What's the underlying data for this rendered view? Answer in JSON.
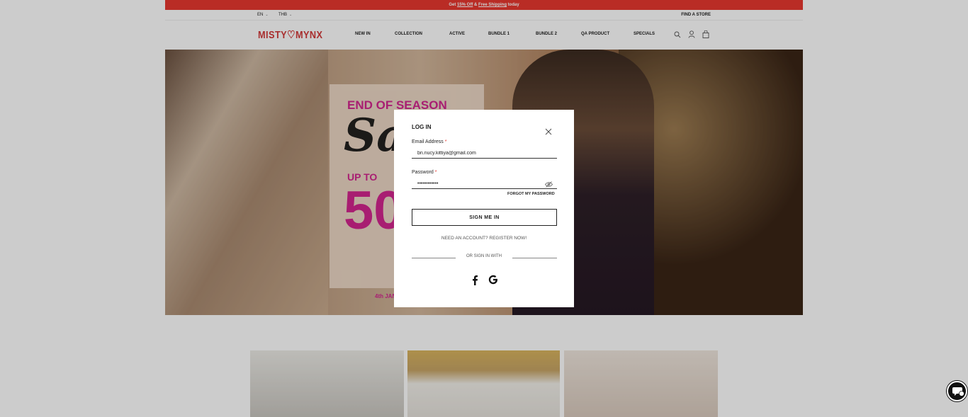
{
  "promo": {
    "prefix": "Get ",
    "discount": "15% Off",
    "middle": " & ",
    "shipping": "Free Shipping",
    "suffix": " today"
  },
  "util": {
    "language": "EN",
    "currency": "THB",
    "find_store": "FIND A STORE"
  },
  "brand": {
    "logo": "MISTY♡MYNX",
    "color": "#d23a3a"
  },
  "nav": {
    "items": [
      "NEW IN",
      "COLLECTION",
      "ACTIVE",
      "BUNDLE 1",
      "BUNDLE 2",
      "QA PRODUCT",
      "SPECIALS"
    ],
    "icons": [
      "search-icon",
      "account-icon",
      "cart-icon"
    ]
  },
  "hero": {
    "line1": "END OF SEASON",
    "line2": "Sa",
    "line3": "UP TO",
    "line4": "50",
    "line5": "4th JAN"
  },
  "login": {
    "title": "LOG IN",
    "email_label": "Email Address",
    "email_value": "bn.nucy.kittiya@gmail.com",
    "password_label": "Password",
    "password_value": "••••••••••••",
    "required_mark": "*",
    "forgot": "FORGOT MY PASSWORD",
    "submit": "SIGN ME IN",
    "register": "NEED AN ACCOUNT? REGISTER NOW!",
    "or_sign_in": "OR SIGN IN WITH",
    "social": [
      "facebook-icon",
      "google-icon"
    ]
  },
  "colors": {
    "promo_bar": "#e8372f",
    "hero_pink": "#d41f8f"
  }
}
